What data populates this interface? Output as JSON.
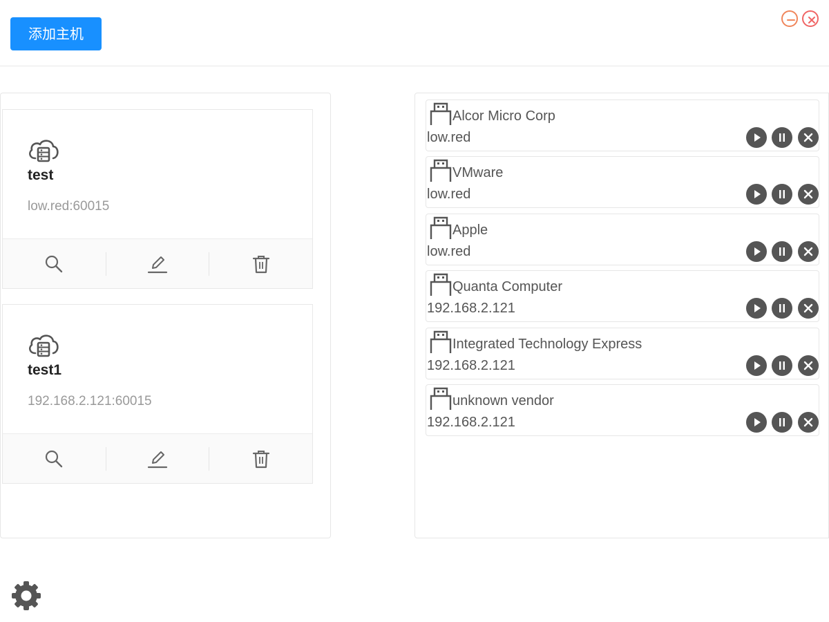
{
  "toolbar": {
    "add_host_label": "添加主机"
  },
  "window_controls": {
    "minimize_icon": "minus-circle-icon",
    "close_icon": "x-circle-icon",
    "minimize_color": "#f0855a",
    "close_color": "#f06464"
  },
  "hosts": [
    {
      "name": "test",
      "address": "low.red:60015"
    },
    {
      "name": "test1",
      "address": "192.168.2.121:60015"
    }
  ],
  "host_actions": [
    "search-icon",
    "edit-icon",
    "trash-icon"
  ],
  "devices": [
    {
      "vendor": "Alcor Micro Corp",
      "host": "low.red"
    },
    {
      "vendor": "VMware",
      "host": "low.red"
    },
    {
      "vendor": "Apple",
      "host": "low.red"
    },
    {
      "vendor": "Quanta Computer",
      "host": "192.168.2.121"
    },
    {
      "vendor": "Integrated Technology Express",
      "host": "192.168.2.121"
    },
    {
      "vendor": "unknown vendor",
      "host": "192.168.2.121"
    }
  ],
  "device_actions": [
    "play-icon",
    "pause-icon",
    "close-icon"
  ],
  "settings": {
    "icon": "gear-icon"
  },
  "colors": {
    "accent": "#1890ff",
    "device_button": "#555555",
    "icon": "#555555"
  }
}
